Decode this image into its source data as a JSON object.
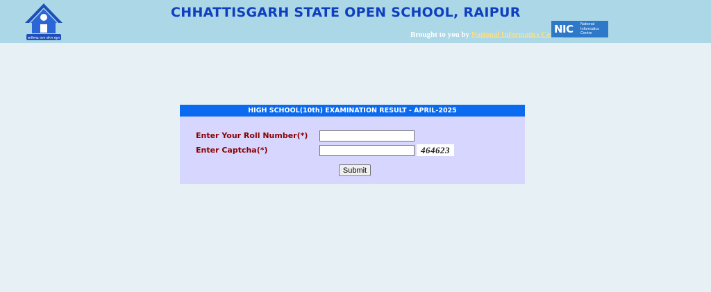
{
  "header": {
    "title": "CHHATTISGARH STATE OPEN SCHOOL, RAIPUR",
    "logo_caption": "छत्तीसगढ़ राज्य ओपन स्कूल",
    "credit_prefix": "Brought to you by",
    "credit_link": "National Informatics Centre",
    "nic_mark": "NIC",
    "nic_text": "National Informatics Centre"
  },
  "form": {
    "heading": "HIGH SCHOOL(10th) EXAMINATION RESULT - APRIL-2025",
    "roll_label": "Enter Your Roll Number(*)",
    "roll_value": "",
    "captcha_label": "Enter Captcha(*)",
    "captcha_value": "",
    "captcha_code": "464623",
    "submit_label": "Submit"
  },
  "colors": {
    "header_bg": "#acd7e6",
    "title": "#0d3fc0",
    "panel_bg": "#d6d6ff",
    "panel_heading": "#0a6af0",
    "label": "#8b0000",
    "page_bg": "#e7f0f5"
  }
}
